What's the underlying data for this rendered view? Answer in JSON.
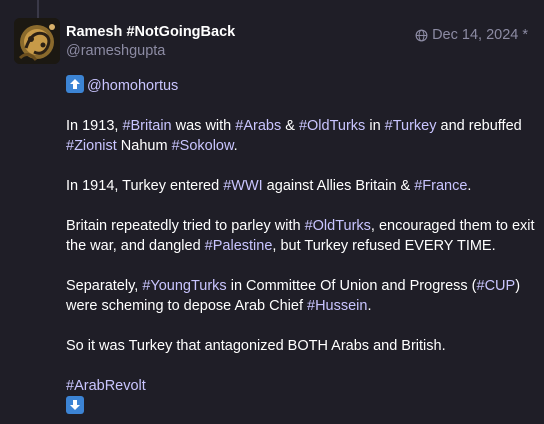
{
  "author": {
    "display_name": "Ramesh #NotGoingBack",
    "handle": "@rameshgupta"
  },
  "meta": {
    "icon": "globe-icon",
    "date": "Dec 14, 2024",
    "edited_marker": "*"
  },
  "post": {
    "reply_icon": "up-arrow-emoji",
    "mention": "@homohortus",
    "p1": {
      "t1": "In 1913, ",
      "tag1": "#Britain",
      "t2": " was with ",
      "tag2": "#Arabs",
      "t3": " & ",
      "tag3": "#OldTurks",
      "t4": " in ",
      "tag4": "#Turkey",
      "t5": " and rebuffed ",
      "tag5": "#Zionist",
      "t6": " Nahum ",
      "tag6": "#Sokolow",
      "t7": "."
    },
    "p2": {
      "t1": "In 1914, Turkey entered ",
      "tag1": "#WWI",
      "t2": " against Allies Britain & ",
      "tag2": "#France",
      "t3": "."
    },
    "p3": {
      "t1": "Britain repeatedly tried to parley with ",
      "tag1": "#OldTurks",
      "t2": ", encouraged them to exit the war, and dangled ",
      "tag2": "#Palestine",
      "t3": ", but Turkey refused EVERY TIME."
    },
    "p4": {
      "t1": "Separately, ",
      "tag1": "#YoungTurks",
      "t2": " in Committee Of Union and Progress (",
      "tag2": "#CUP",
      "t3": ") were scheming to depose Arab Chief ",
      "tag3": "#Hussein",
      "t4": "."
    },
    "p5": {
      "t1": "So it was Turkey that antagonized BOTH Arabs and British."
    },
    "p6": {
      "tag1": "#ArabRevolt"
    },
    "continue_icon": "down-arrow-emoji"
  },
  "colors": {
    "background": "#1f1e27",
    "text": "#ffffff",
    "hashtag": "#c9c5ff",
    "muted": "#8c8ba3",
    "emoji_box": "#3c84d4"
  }
}
